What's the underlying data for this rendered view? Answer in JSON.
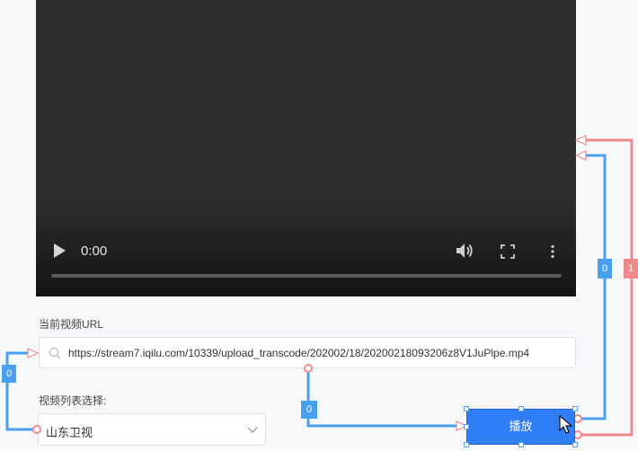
{
  "video": {
    "time_display": "0:00",
    "progress_fraction": 0
  },
  "form": {
    "url_label": "当前视频URL",
    "url_value": "https://stream7.iqilu.com/10339/upload_transcode/202002/18/20200218093206z8V1JuPlpe.mp4",
    "list_label": "视频列表选择:",
    "list_selected": "山东卫视"
  },
  "actions": {
    "play_label": "播放"
  },
  "wires": {
    "tag_url": "0",
    "tag_select_out": "0",
    "tag_blue_right": "0",
    "tag_red_right": "1",
    "blue_color": "#4aa0f0",
    "red_color": "#f08a8a"
  },
  "icons": [
    "play-icon",
    "volume-icon",
    "fullscreen-icon",
    "more-icon",
    "search-icon",
    "chevron-down-icon",
    "cursor-icon"
  ]
}
